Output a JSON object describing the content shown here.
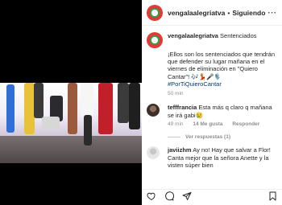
{
  "account": {
    "username": "vengalaalegriatva",
    "follow_label": "Siguiendo",
    "separator": "•"
  },
  "caption": {
    "username": "vengalaalegriatva",
    "first": "Sentenciados",
    "text": "¡Ellos son los sentenciados que tendrán que defender su lugar mañana en el viernes de eliminación en \"Quiero Cantar\"! 🎶💃🎤🎙️",
    "hashtag": "#PorTiQuieroCantar",
    "time": "50 min"
  },
  "comments": [
    {
      "username": "tefffrancia",
      "text": "Esta más q claro q mañana se irá gabi😢",
      "time": "49 min",
      "likes": "14 Me gusta",
      "reply": "Responder",
      "view_replies": "Ver respuestas (1)"
    },
    {
      "username": "javiizhm",
      "text": "Ay no! Hay que salvar a Flor! Canta mejor que la señora Anette y la visten súper bien"
    }
  ],
  "icons": [
    "heart-icon",
    "comment-icon",
    "share-icon",
    "bookmark-icon",
    "more-options-icon"
  ]
}
